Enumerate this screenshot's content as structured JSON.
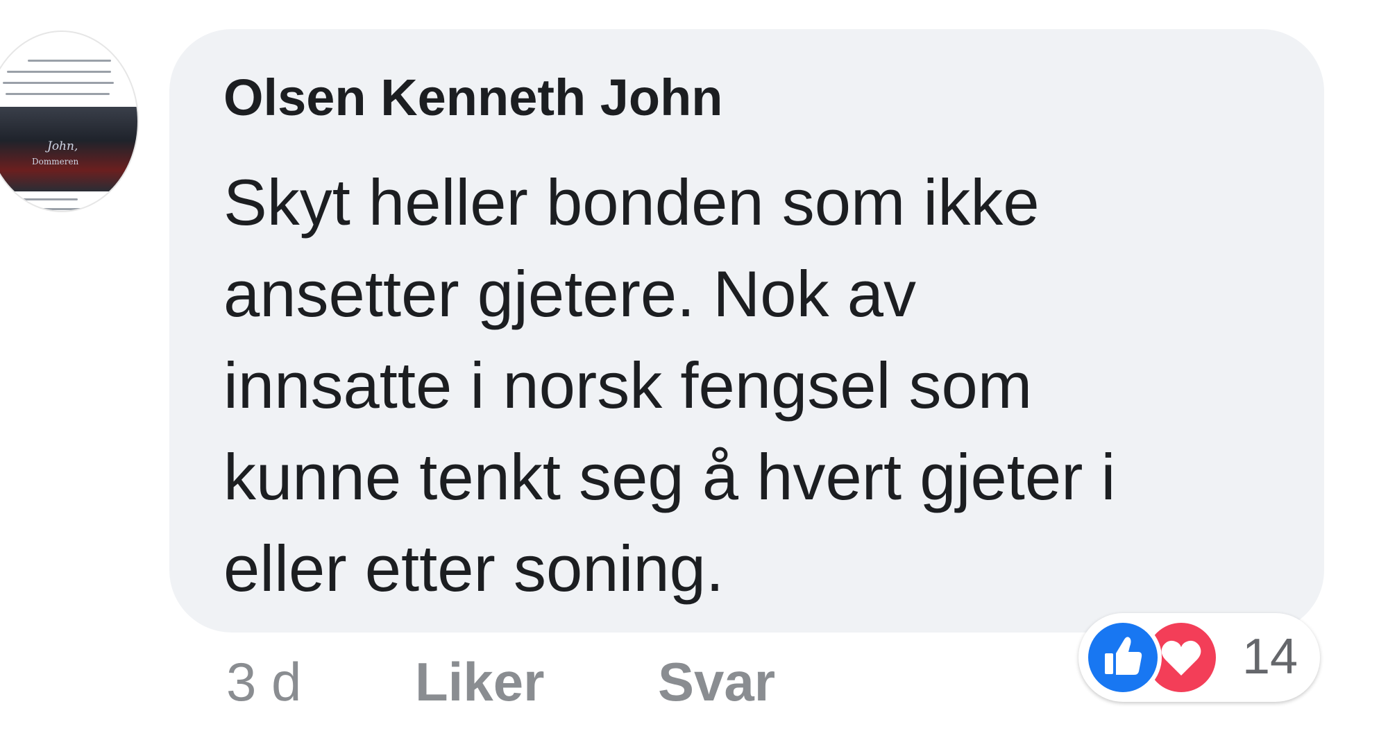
{
  "comment": {
    "author": "Olsen Kenneth John",
    "body_lines": [
      "Skyt heller bonden som ikke",
      "ansetter gjetere. Nok av",
      "innsatte i norsk fengsel som",
      "kunne tenkt seg å hvert gjeter i",
      "eller etter soning."
    ],
    "avatar": {
      "script_text": "John,",
      "caption_text": "Dommeren"
    },
    "footer": {
      "time": "3 d",
      "like_label": "Liker",
      "reply_label": "Svar"
    },
    "reactions": {
      "icons": [
        "thumbs-up-icon",
        "heart-icon"
      ],
      "count": "14"
    }
  },
  "colors": {
    "bubble": "#f0f2f5",
    "text": "#1c1e21",
    "muted": "#8a8d91",
    "like_blue": "#1877f2",
    "love_red": "#f33e58"
  }
}
